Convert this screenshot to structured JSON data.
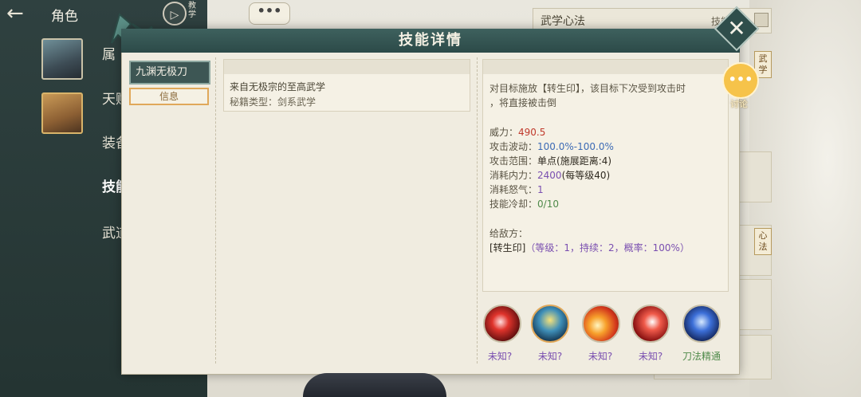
{
  "topbar": {
    "back_icon": "arrow-left-icon",
    "title": "角色",
    "teach_label": "教学"
  },
  "sidebar": {
    "tabs": [
      {
        "label": "属"
      },
      {
        "label": "天赋"
      },
      {
        "label": "装备"
      },
      {
        "label": "技能"
      },
      {
        "label": "武道"
      }
    ]
  },
  "right_panel": {
    "title": "武学心法",
    "right_text": "技能",
    "badges": [
      "武学",
      "心法"
    ]
  },
  "modal": {
    "title": "技能详情",
    "skill_name": "九渊无极刀",
    "info_tab": "信息",
    "desc_line1": "来自无极宗的至高武学",
    "desc_line2": "秘籍类型：剑系武学",
    "effect_line1": "对目标施放【转生印】，该目标下次受到攻击时",
    "effect_line2": "，将直接被击倒",
    "stats": {
      "power_label": "威力：",
      "power_value": "490.5",
      "fluct_label": "攻击波动：",
      "fluct_value": "100.0%-100.0%",
      "range_label": "攻击范围：",
      "range_value": "单点(施展距离:4)",
      "mp_label": "消耗内力：",
      "mp_value": "2400",
      "mp_extra": "(每等级40)",
      "rage_label": "消耗怒气：",
      "rage_value": "1",
      "cd_label": "技能冷却：",
      "cd_value": "0/10"
    },
    "enemy_label": "给敌方：",
    "buff_name": "[转生印]",
    "buff_detail": "（等级：1，持续：2，概率：100%）"
  },
  "skills": [
    {
      "label": "未知?",
      "icon": "red-slash-icon"
    },
    {
      "label": "未知?",
      "icon": "golden-warrior-icon"
    },
    {
      "label": "未知?",
      "icon": "fire-burst-icon"
    },
    {
      "label": "未知?",
      "icon": "red-claw-icon"
    },
    {
      "label": "刀法精通",
      "icon": "blue-spirit-icon"
    }
  ],
  "chat_right_label": "讨论"
}
